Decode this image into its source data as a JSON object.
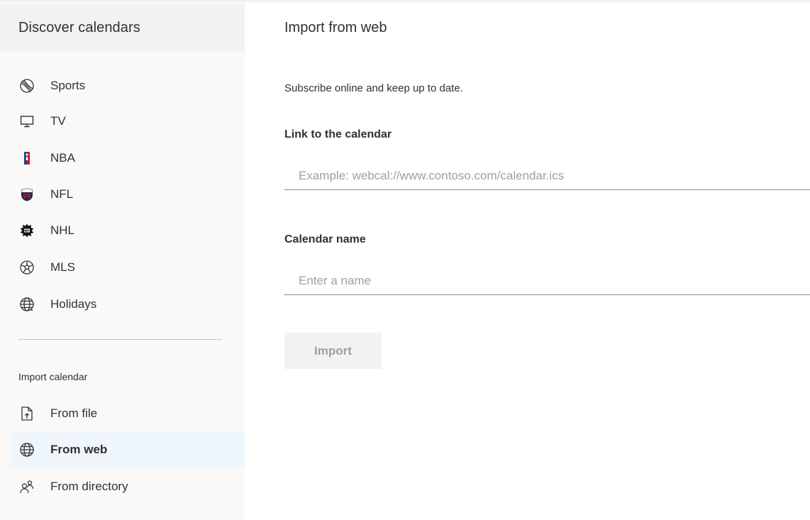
{
  "sidebar": {
    "title": "Discover calendars",
    "items": [
      {
        "label": "Sports",
        "icon": "sports-ball-icon"
      },
      {
        "label": "TV",
        "icon": "tv-monitor-icon"
      },
      {
        "label": "NBA",
        "icon": "nba-logo-icon"
      },
      {
        "label": "NFL",
        "icon": "nfl-logo-icon"
      },
      {
        "label": "NHL",
        "icon": "nhl-logo-icon"
      },
      {
        "label": "MLS",
        "icon": "mls-logo-icon"
      },
      {
        "label": "Holidays",
        "icon": "globe-icon"
      }
    ],
    "import_section_label": "Import calendar",
    "import_items": [
      {
        "label": "From file",
        "icon": "file-upload-icon"
      },
      {
        "label": "From web",
        "icon": "globe-icon",
        "selected": true
      },
      {
        "label": "From directory",
        "icon": "people-icon"
      }
    ]
  },
  "main": {
    "title": "Import from web",
    "subtitle": "Subscribe online and keep up to date.",
    "link_label": "Link to the calendar",
    "link_placeholder": "Example: webcal://www.contoso.com/calendar.ics",
    "link_value": "",
    "name_label": "Calendar name",
    "name_placeholder": "Enter a name",
    "name_value": "",
    "import_button": "Import"
  },
  "colors": {
    "sidebar_header_bg": "#f3f2f1",
    "sidebar_bg": "#faf9f8",
    "selected_bg": "#eff6fc",
    "text": "#323130",
    "placeholder": "#a19f9d",
    "disabled_button_bg": "#f3f2f1",
    "nba_blue": "#1d428a",
    "nba_red": "#c8102e"
  }
}
